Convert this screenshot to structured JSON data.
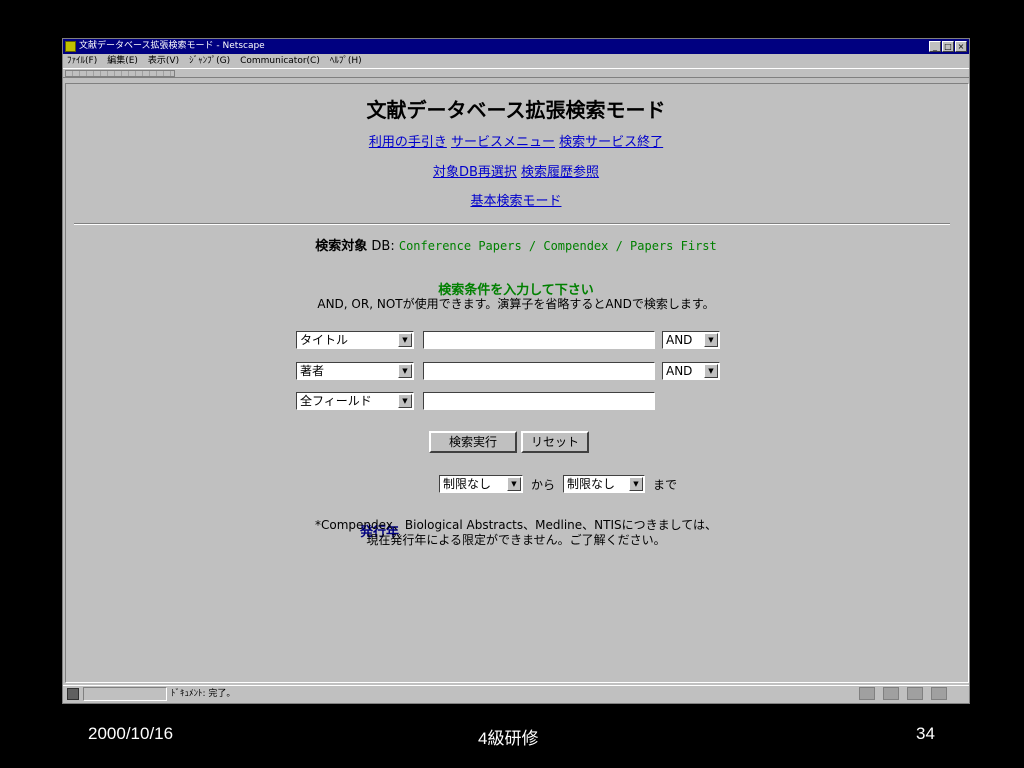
{
  "window": {
    "title": "文献データベース拡張検索モード - Netscape",
    "controls": [
      "_",
      "□",
      "×"
    ]
  },
  "menu": [
    "ﾌｧｲﾙ(F)",
    "編集(E)",
    "表示(V)",
    "ｼﾞｬﾝﾌﾟ(G)",
    "Communicator(C)",
    "ﾍﾙﾌﾟ(H)"
  ],
  "page": {
    "heading": "文献データベース拡張検索モード",
    "links_row1": [
      "利用の手引き",
      "サービスメニュー",
      "検索サービス終了"
    ],
    "links_row2": [
      "対象DB再選択",
      "検索履歴参照"
    ],
    "links_row3": [
      "基本検索モード"
    ],
    "target_label": "検索対象",
    "target_db_prefix": "DB:",
    "target_value": "Conference Papers / Compendex / Papers First",
    "prompt": "検索条件を入力して下さい",
    "hint": "AND, OR, NOTが使用できます。演算子を省略するとANDで検索します。",
    "rows": [
      {
        "field": "タイトル",
        "value": "",
        "op": "AND"
      },
      {
        "field": "著者",
        "value": "",
        "op": "AND"
      },
      {
        "field": "全フィールド",
        "value": ""
      }
    ],
    "submit_label": "検索実行",
    "reset_label": "リセット",
    "year_label": "発行年",
    "year_from": "制限なし",
    "from_text": "から",
    "year_to": "制限なし",
    "to_text": "まで",
    "note_line1": "*Compendex、Biological Abstracts、Medline、NTISにつきましては、",
    "note_line2": "現在発行年による限定ができません。ご了解ください。"
  },
  "status": {
    "text": "ﾄﾞｷｭﾒﾝﾄ: 完了。"
  },
  "slide_footer": {
    "date": "2000/10/16",
    "center": "4級研修",
    "page": "34"
  }
}
